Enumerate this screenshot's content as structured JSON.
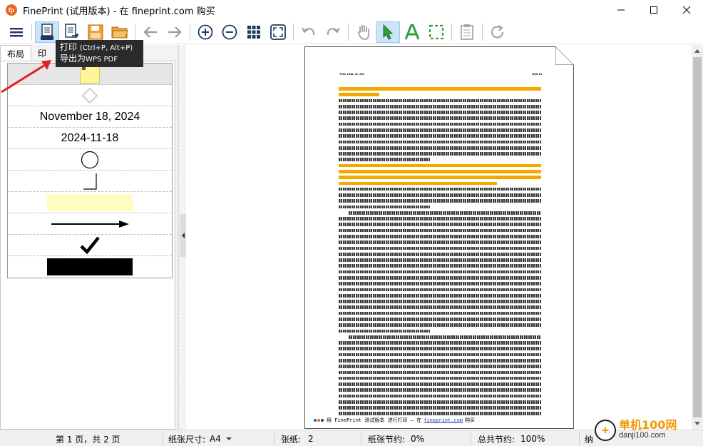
{
  "window": {
    "title": "FinePrint (试用版本) - 在 fineprint.com 购买",
    "app_icon": "fp"
  },
  "toolbar": {
    "icons": [
      "menu-icon",
      "print-icon",
      "export-pdf-icon",
      "save-icon",
      "open-folder-icon",
      "back-icon",
      "forward-icon",
      "zoom-in-icon",
      "zoom-out-icon",
      "grid-icon",
      "fit-page-icon",
      "undo-icon",
      "redo-icon",
      "hand-icon",
      "select-arrow-icon",
      "text-icon",
      "marquee-icon",
      "notes-icon",
      "refresh-icon"
    ]
  },
  "tooltip": {
    "line1": "打印",
    "line1_shortcut": "(Ctrl+P, Alt+P)",
    "line2": "导出为",
    "line2_app": "WPS PDF"
  },
  "left_panel": {
    "tabs": [
      "布局",
      "印"
    ],
    "stamps": {
      "date_long": "November 18, 2024",
      "date_iso": "2024-11-18"
    }
  },
  "page": {
    "header_left": "Time 1918, 22, 283",
    "header_right": "Bolt 14",
    "footer_app": "用 FinePrint 测试版本 进行打印 – 在",
    "footer_link": "fineprint.com",
    "footer_end": "购买"
  },
  "statusbar": {
    "page_info": "第 1 页，共 2 页",
    "paper_size_label": "纸张尺寸:",
    "paper_size_value": "A4",
    "sheets_label": "张纸:",
    "sheets_value": "2",
    "paper_saving_label": "纸张节约:",
    "paper_saving_value": "0%",
    "total_saving_label": "总共节约:",
    "total_saving_value": "100%",
    "extra": "纳"
  },
  "watermark": {
    "name": "单机100网",
    "url": "danji100.com"
  },
  "colors": {
    "highlight": "#f5a800",
    "accent_green": "#2e9e3e",
    "folder_orange": "#f0a030",
    "red_arrow": "#e02020"
  }
}
